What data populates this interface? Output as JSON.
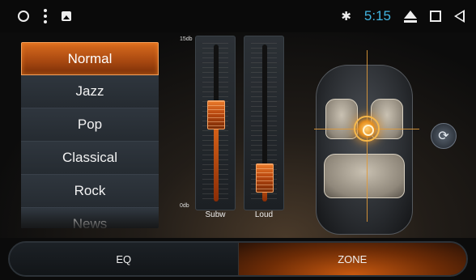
{
  "statusbar": {
    "icons_left": [
      "circle-icon",
      "more-vertical-icon",
      "gallery-icon"
    ],
    "bluetooth_icon": "bluetooth-icon",
    "time": "5:15",
    "icons_right": [
      "eject-icon",
      "square-icon",
      "back-icon"
    ]
  },
  "presets": {
    "items": [
      "Normal",
      "Jazz",
      "Pop",
      "Classical",
      "Rock",
      "News"
    ],
    "selected": "Normal"
  },
  "sliders": {
    "scale_top": "15db",
    "scale_bottom": "0db",
    "subw": {
      "label": "Subw",
      "level": 0.55
    },
    "loud": {
      "label": "Loud",
      "level": 0.15
    }
  },
  "zone": {
    "rotate_icon": "rotate-icon"
  },
  "tabs": {
    "eq": "EQ",
    "zone": "ZONE",
    "active": "ZONE"
  },
  "colors": {
    "accent": "#e0751f",
    "time": "#41b4e0"
  }
}
